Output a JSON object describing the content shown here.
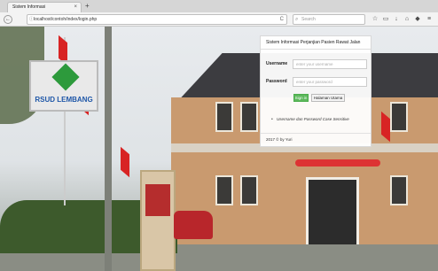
{
  "browser": {
    "tab_title": "Sistem Informasi",
    "tab_close": "×",
    "new_tab": "+",
    "back": "←",
    "address": "localhost/contoh/index/login.php",
    "address_info": "ⓘ",
    "reload": "C",
    "search_placeholder": "Search",
    "search_icon": "⌕",
    "toolbar_icons": [
      "star-icon",
      "clipboard-icon",
      "download-icon",
      "home-icon",
      "pocket-icon",
      "menu-icon"
    ],
    "toolbar_glyphs": [
      "☆",
      "▭",
      "↓",
      "⌂",
      "◆",
      "≡"
    ]
  },
  "scene": {
    "sign_text": "RSUD LEMBANG"
  },
  "login": {
    "title": "Sistem Informasi Perjanjian Pasien Rawat Jalan",
    "username_label": "Username",
    "username_placeholder": "enter your username",
    "password_label": "Password",
    "password_placeholder": "enter your password",
    "signin_label": "Sign in",
    "home_label": "Halaman Utama",
    "note_bullet": "•",
    "note": "Username dan Password Case Sensitive",
    "footer": "2017 © by Yuri"
  },
  "colors": {
    "signin_bg": "#5cb85c",
    "flag_red": "#d82424",
    "sign_green": "#2d9a3c"
  }
}
